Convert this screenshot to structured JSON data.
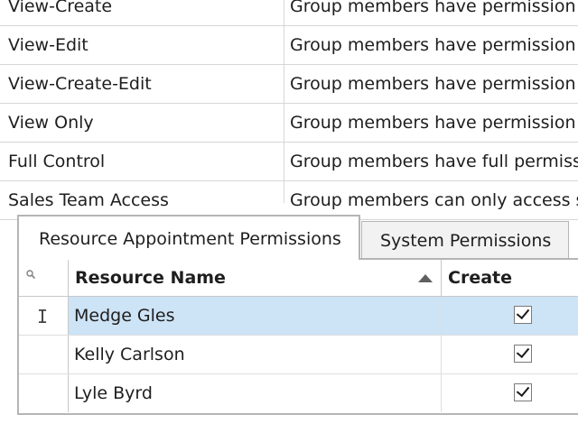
{
  "groups_grid": {
    "rows": [
      {
        "name": "View-Create",
        "description": "Group members have permission t"
      },
      {
        "name": "View-Edit",
        "description": "Group members have permission t"
      },
      {
        "name": "View-Create-Edit",
        "description": "Group members have permission t"
      },
      {
        "name": "View Only",
        "description": "Group members have permission t"
      },
      {
        "name": "Full Control",
        "description": "Group members have full permissi"
      },
      {
        "name": "Sales Team Access",
        "description": "Group members can only access s"
      }
    ]
  },
  "tabs": [
    {
      "label": "Resource Appointment Permissions",
      "active": true
    },
    {
      "label": "System Permissions",
      "active": false
    }
  ],
  "resource_grid": {
    "columns": {
      "name": "Resource Name",
      "create": "Create"
    },
    "sort": "ascending",
    "rows": [
      {
        "name": "Medge Gles",
        "create": true,
        "selected": true
      },
      {
        "name": "Kelly Carlson",
        "create": true,
        "selected": false
      },
      {
        "name": "Lyle Byrd",
        "create": true,
        "selected": false
      }
    ]
  },
  "icons": {
    "filter": "search-icon",
    "sort": "sort-ascending-icon",
    "cursor": "text-cursor-icon"
  },
  "colors": {
    "selection": "#cde3f6",
    "border": "#b5b5b5",
    "grid_line": "#d6d6d6"
  }
}
